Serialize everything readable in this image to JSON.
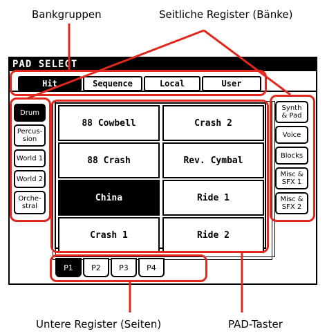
{
  "captions": {
    "bankgroups": "Bankgruppen",
    "side_tabs": "Seitliche Register (Bänke)",
    "bottom_tabs": "Untere Register (Seiten)",
    "pad_buttons": "PAD-Taster"
  },
  "window": {
    "title": "PAD SELECT"
  },
  "bank_groups": [
    {
      "label": "Hit",
      "selected": true
    },
    {
      "label": "Sequence",
      "selected": false
    },
    {
      "label": "Local",
      "selected": false
    },
    {
      "label": "User",
      "selected": false
    }
  ],
  "left_banks": [
    {
      "label": "Drum",
      "selected": true
    },
    {
      "label": "Percus-\nsion",
      "selected": false
    },
    {
      "label": "World 1",
      "selected": false
    },
    {
      "label": "World 2",
      "selected": false
    },
    {
      "label": "Orche-\nstral",
      "selected": false
    }
  ],
  "right_banks": [
    {
      "label": "Synth\n& Pad"
    },
    {
      "label": "Voice"
    },
    {
      "label": "Blocks"
    },
    {
      "label": "Misc &\nSFX 1"
    },
    {
      "label": "Misc &\nSFX 2"
    }
  ],
  "pads": [
    {
      "label": "88 Cowbell",
      "selected": false
    },
    {
      "label": "Crash 2",
      "selected": false
    },
    {
      "label": "88 Crash",
      "selected": false
    },
    {
      "label": "Rev. Cymbal",
      "selected": false
    },
    {
      "label": "China",
      "selected": true
    },
    {
      "label": "Ride 1",
      "selected": false
    },
    {
      "label": "Crash 1",
      "selected": false
    },
    {
      "label": "Ride 2",
      "selected": false
    }
  ],
  "pages": [
    {
      "label": "P1",
      "selected": true
    },
    {
      "label": "P2",
      "selected": false
    },
    {
      "label": "P3",
      "selected": false
    },
    {
      "label": "P4",
      "selected": false
    }
  ],
  "colors": {
    "callout": "#e0281e",
    "screen_fg": "#000000",
    "screen_bg": "#ffffff"
  }
}
